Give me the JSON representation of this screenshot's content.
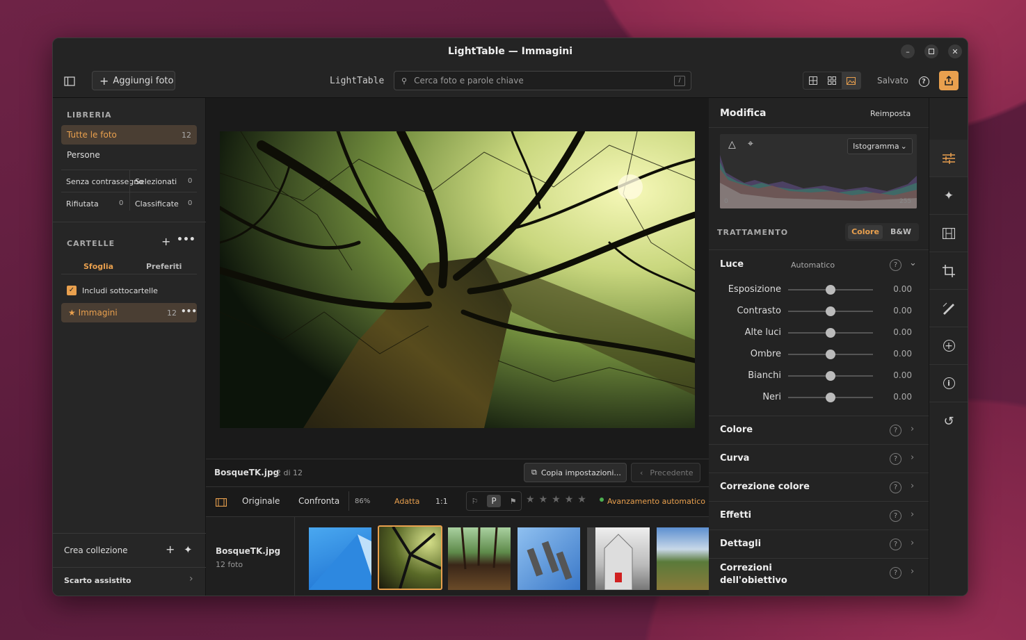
{
  "window": {
    "title": "LightTable — Immagini"
  },
  "toolbar": {
    "add_photos": "Aggiungi foto",
    "app_name": "LightTable",
    "search_placeholder": "Cerca foto e parole chiave",
    "search_shortcut": "/",
    "saved": "Salvato"
  },
  "library": {
    "title": "LIBRERIA",
    "all_photos": "Tutte le foto",
    "all_count": "12",
    "people": "Persone",
    "unflagged": "Senza contrassegno",
    "selected": "Selezionati",
    "selected_count": "0",
    "rejected": "Rifiutata",
    "rejected_count": "0",
    "rated": "Classificate",
    "rated_count": "0"
  },
  "folders": {
    "title": "CARTELLE",
    "tab_browse": "Sfoglia",
    "tab_favorites": "Preferiti",
    "include_sub": "Includi sottocartelle",
    "folder_name": "★ Immagini",
    "folder_count": "12"
  },
  "collections": {
    "create": "Crea collezione",
    "assisted_cull": "Scarto assistito"
  },
  "photo": {
    "name": "BosqueTK.jpg",
    "position": "2 di 12",
    "copy_settings": "Copia impostazioni...",
    "previous": "Precedente"
  },
  "viewbar": {
    "original": "Originale",
    "compare": "Confronta",
    "zoom": "86%",
    "fit": "Adatta",
    "one_to_one": "1:1",
    "pick_label": "P",
    "auto_advance": "Avanzamento automatico"
  },
  "filmstrip": {
    "name": "BosqueTK.jpg",
    "count": "12 foto"
  },
  "edit": {
    "title": "Modifica",
    "reset": "Reimposta",
    "histogram_mode": "Istogramma",
    "hist_min": "0",
    "hist_max": "255",
    "treatment": "TRATTAMENTO",
    "color": "Colore",
    "bw": "B&W"
  },
  "light": {
    "title": "Luce",
    "mode": "Automatico",
    "sliders": [
      {
        "name": "Esposizione",
        "value": "0.00",
        "level": 0.5
      },
      {
        "name": "Contrasto",
        "value": "0.00",
        "level": 0.5
      },
      {
        "name": "Alte luci",
        "value": "0.00",
        "level": 0.5
      },
      {
        "name": "Ombre",
        "value": "0.00",
        "level": 0.5
      },
      {
        "name": "Bianchi",
        "value": "0.00",
        "level": 0.5
      },
      {
        "name": "Neri",
        "value": "0.00",
        "level": 0.5
      }
    ]
  },
  "sections": [
    "Colore",
    "Curva",
    "Correzione colore",
    "Effetti",
    "Dettagli",
    "Correzioni dell'obiettivo"
  ],
  "colors": {
    "accent": "#e9a04e",
    "selection": "#5a4a3a"
  }
}
